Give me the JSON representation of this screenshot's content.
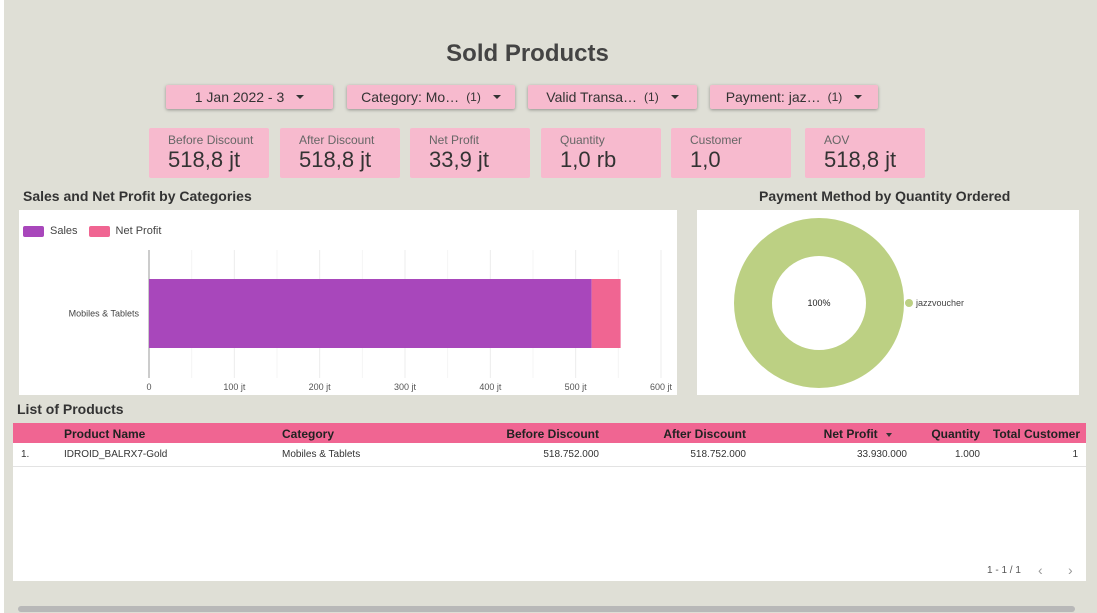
{
  "page": {
    "title": "Sold Products"
  },
  "filters": [
    {
      "label": "1 Jan 2022 - 3",
      "count": ""
    },
    {
      "label": "Category: Mo…",
      "count": "(1)"
    },
    {
      "label": "Valid Transa…",
      "count": "(1)"
    },
    {
      "label": "Payment: jaz…",
      "count": "(1)"
    }
  ],
  "kpis": [
    {
      "label": "Before Discount",
      "value": "518,8 jt"
    },
    {
      "label": "After Discount",
      "value": "518,8 jt"
    },
    {
      "label": "Net Profit",
      "value": "33,9 jt"
    },
    {
      "label": "Quantity",
      "value": "1,0 rb"
    },
    {
      "label": "Customer",
      "value": "1,0"
    },
    {
      "label": "AOV",
      "value": "518,8 jt"
    }
  ],
  "bar_section": {
    "title": "Sales and Net Profit by Categories"
  },
  "pie_section": {
    "title": "Payment Method by Quantity Ordered"
  },
  "table_section": {
    "title": "List of Products"
  },
  "colors": {
    "sales": "#a847bb",
    "net_profit": "#f06592",
    "donut": "#bcd083",
    "header_bg": "#f06592",
    "card_bg": "#f7bace",
    "canvas_bg": "#dfdfd6"
  },
  "chart_data": [
    {
      "type": "bar",
      "orientation": "horizontal",
      "stacked": true,
      "categories": [
        "Mobiles & Tablets"
      ],
      "series": [
        {
          "name": "Sales",
          "values": [
            518.752
          ]
        },
        {
          "name": "Net Profit",
          "values": [
            33.93
          ]
        }
      ],
      "xlim": [
        0,
        600
      ],
      "xticks": [
        "0",
        "100 jt",
        "200 jt",
        "300 jt",
        "400 jt",
        "500 jt",
        "600 jt"
      ],
      "grid": true,
      "legend": "top-left"
    },
    {
      "type": "pie",
      "donut": true,
      "labels": [
        "jazzvoucher"
      ],
      "values": [
        100
      ],
      "center_label": "100%",
      "legend": "right"
    }
  ],
  "table": {
    "columns": [
      "Product Name",
      "Category",
      "Before Discount",
      "After Discount",
      "Net Profit",
      "Quantity",
      "Total Customer"
    ],
    "rows": [
      {
        "index": "1.",
        "product": "IDROID_BALRX7-Gold",
        "category": "Mobiles & Tablets",
        "before": "518.752.000",
        "after": "518.752.000",
        "profit": "33.930.000",
        "qty": "1.000",
        "customers": "1"
      }
    ],
    "pager": "1 - 1 / 1"
  }
}
